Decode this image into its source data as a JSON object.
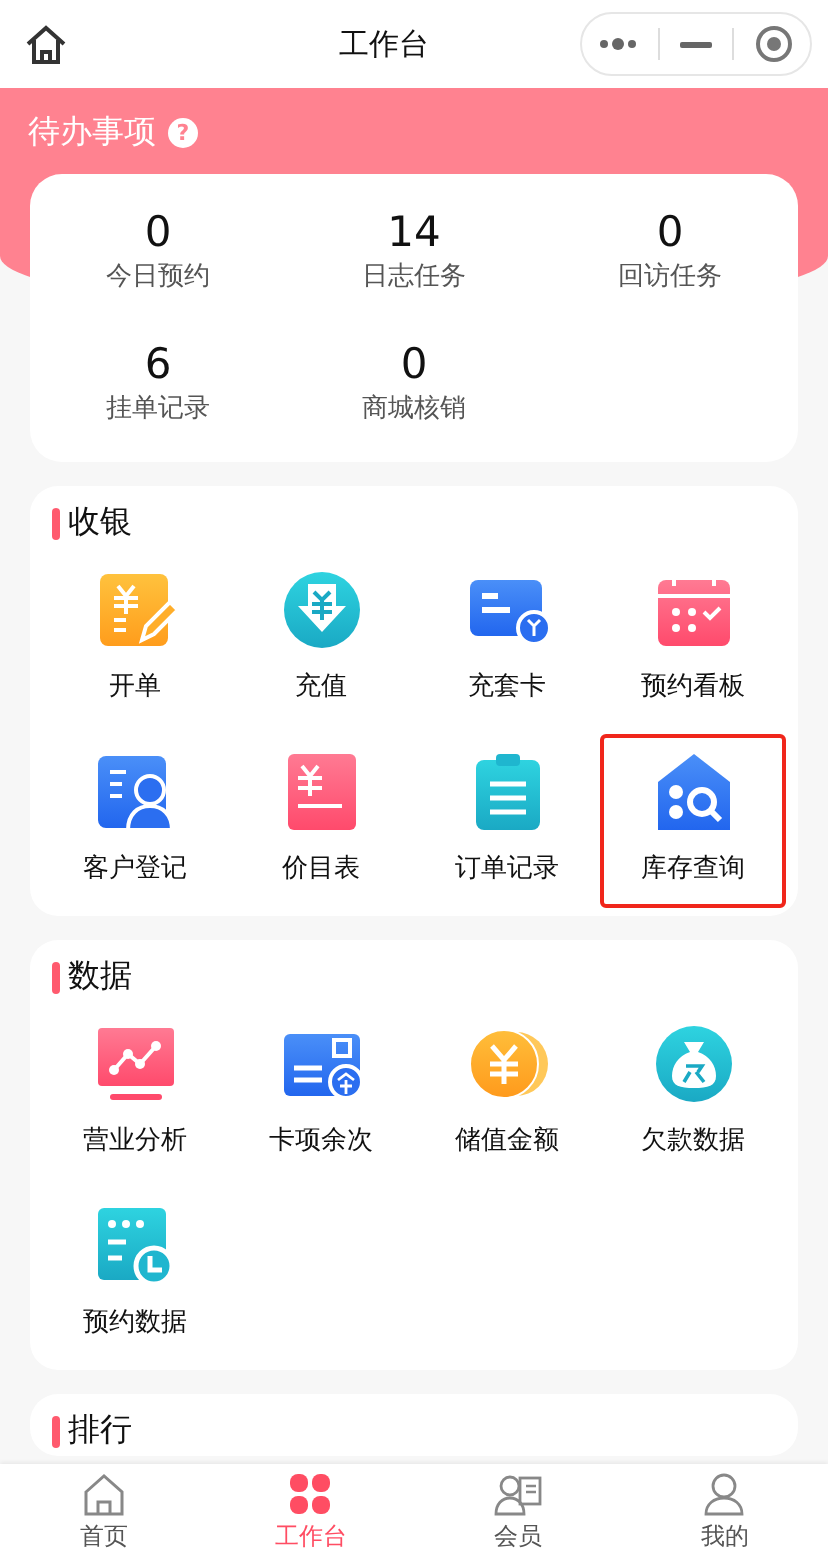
{
  "nav_bar": {
    "title": "工作台"
  },
  "todo": {
    "title": "待办事项",
    "help": "?",
    "stats": [
      {
        "value": "0",
        "label": "今日预约"
      },
      {
        "value": "14",
        "label": "日志任务"
      },
      {
        "value": "0",
        "label": "回访任务"
      },
      {
        "value": "6",
        "label": "挂单记录"
      },
      {
        "value": "0",
        "label": "商城核销"
      }
    ]
  },
  "sections": [
    {
      "title": "收银",
      "items": [
        {
          "label": "开单",
          "highlighted": false
        },
        {
          "label": "充值",
          "highlighted": false
        },
        {
          "label": "充套卡",
          "highlighted": false
        },
        {
          "label": "预约看板",
          "highlighted": false
        },
        {
          "label": "客户登记",
          "highlighted": false
        },
        {
          "label": "价目表",
          "highlighted": false
        },
        {
          "label": "订单记录",
          "highlighted": false
        },
        {
          "label": "库存查询",
          "highlighted": true
        }
      ]
    },
    {
      "title": "数据",
      "items": [
        {
          "label": "营业分析",
          "highlighted": false
        },
        {
          "label": "卡项余次",
          "highlighted": false
        },
        {
          "label": "储值金额",
          "highlighted": false
        },
        {
          "label": "欠款数据",
          "highlighted": false
        },
        {
          "label": "预约数据",
          "highlighted": false
        }
      ]
    },
    {
      "title": "排行"
    }
  ],
  "tab_bar": [
    {
      "label": "首页",
      "selected": false
    },
    {
      "label": "工作台",
      "selected": true
    },
    {
      "label": "会员",
      "selected": false
    },
    {
      "label": "我的",
      "selected": false
    }
  ]
}
